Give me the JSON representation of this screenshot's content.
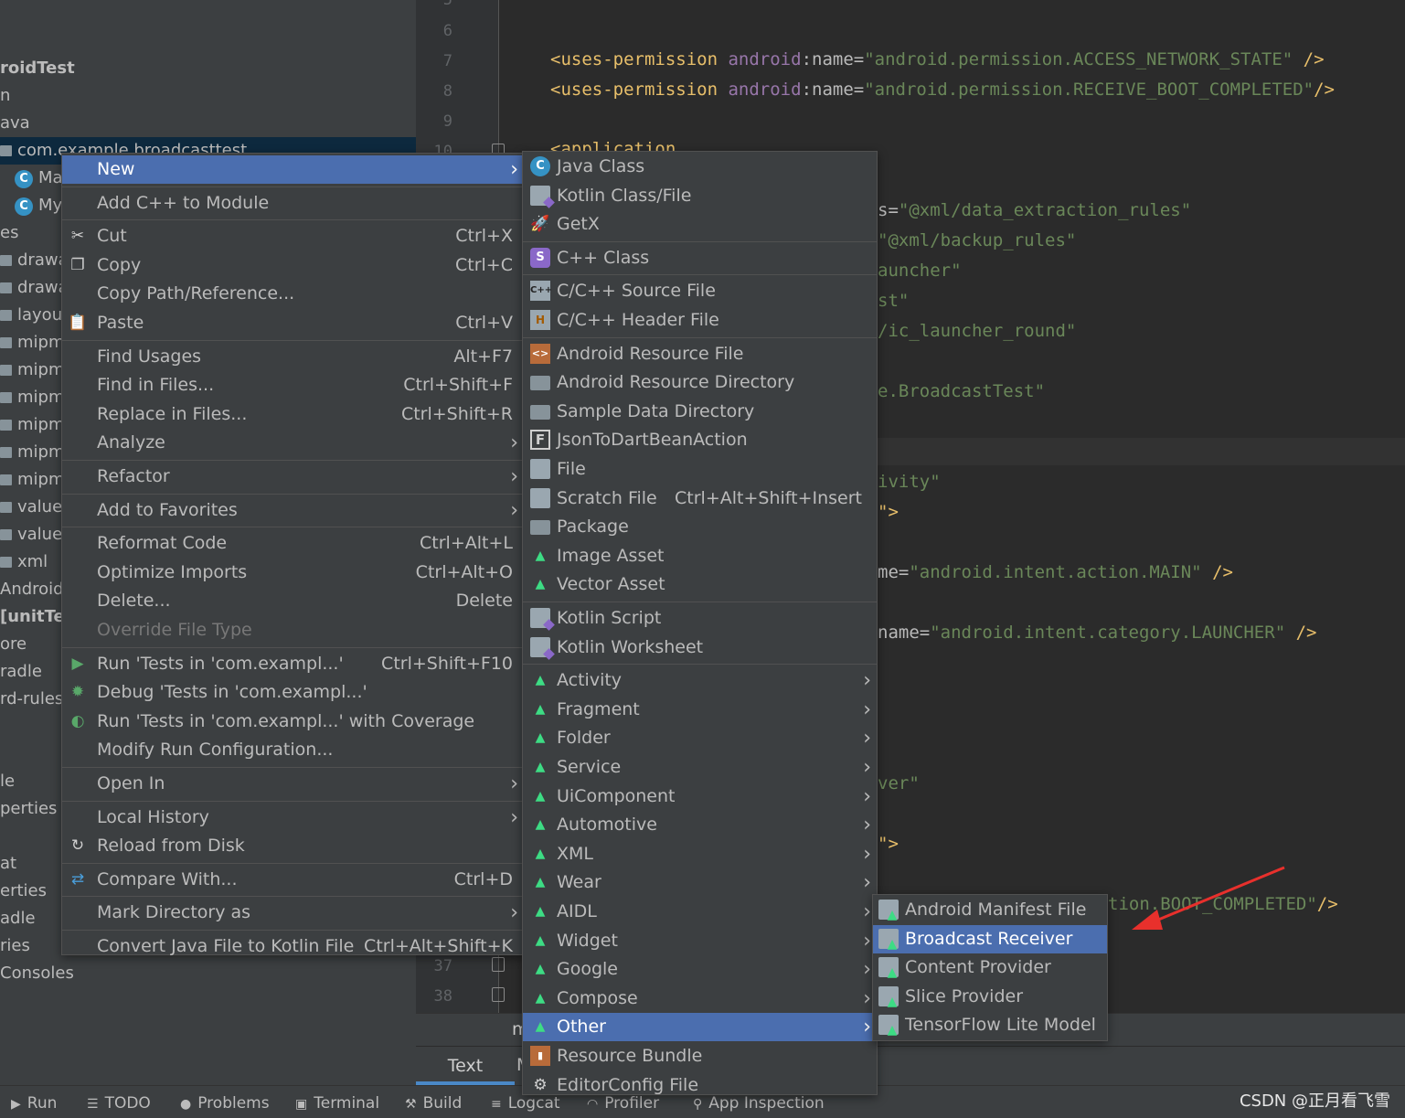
{
  "project_tree": [
    {
      "text": "roidTest",
      "bold": true
    },
    {
      "text": "n"
    },
    {
      "text": "ava"
    },
    {
      "text": "com.example.broadcasttest",
      "selected": true
    },
    {
      "text": "Ma",
      "class_icon": "C"
    },
    {
      "text": "My",
      "class_icon": "C"
    },
    {
      "text": "es"
    },
    {
      "text": "drawa",
      "folder": true
    },
    {
      "text": "drawa",
      "folder": true
    },
    {
      "text": "layout",
      "folder": true
    },
    {
      "text": "mipm",
      "folder": true
    },
    {
      "text": "mipm",
      "folder": true
    },
    {
      "text": "mipm",
      "folder": true
    },
    {
      "text": "mipm",
      "folder": true
    },
    {
      "text": "mipm",
      "folder": true
    },
    {
      "text": "mipm",
      "folder": true
    },
    {
      "text": "values",
      "folder": true
    },
    {
      "text": "values",
      "folder": true
    },
    {
      "text": "xml",
      "folder": true
    },
    {
      "text": "AndroidM"
    },
    {
      "text": "[unitTes",
      "bold": true
    },
    {
      "text": "ore"
    },
    {
      "text": "radle"
    },
    {
      "text": "rd-rules"
    },
    {
      "text": ""
    },
    {
      "text": ""
    },
    {
      "text": "le"
    },
    {
      "text": "perties"
    },
    {
      "text": ""
    },
    {
      "text": "at"
    },
    {
      "text": "erties"
    },
    {
      "text": "adle"
    },
    {
      "text": "ries"
    },
    {
      "text": " Consoles"
    }
  ],
  "line_numbers": [
    "5",
    "6",
    "7",
    "8",
    "9",
    "10",
    "37",
    "38"
  ],
  "code": {
    "l7_tag": "<uses-permission",
    "l7_ns": "android",
    "l7_attr": ":name=",
    "l7_val": "\"android.permission.ACCESS_NETWORK_STATE\"",
    "l7_end": " />",
    "l8_tag": "<uses-permission",
    "l8_ns": "android",
    "l8_attr": ":name=",
    "l8_val": "\"android.permission.RECEIVE_BOOT_COMPLETED\"",
    "l8_end": "/>",
    "l10": "<application",
    "f1_a": "s=",
    "f1_b": "\"@xml/data_extraction_rules\"",
    "f2": "\"@xml/backup_rules\"",
    "f3": "auncher\"",
    "f4": "st\"",
    "f5": "/ic_launcher_round\"",
    "f6": "e.BroadcastTest\"",
    "f7": "ivity\"",
    "f8": "\">",
    "f9_a": "me=",
    "f9_b": "\"android.intent.action.MAIN\"",
    "f9_c": " />",
    "f10_a": "name=",
    "f10_b": "\"android.intent.category.LAUNCHER\"",
    "f10_c": " />",
    "f11": "ver\"",
    "f12": "\">",
    "f13_a": "tion.BOOT_COMPLETED\"",
    "f13_b": "/>"
  },
  "editor_footer": {
    "text_tab": "Text",
    "m": "m",
    "M": "M"
  },
  "context_menu": {
    "items": [
      {
        "label": "New",
        "arrow": true,
        "selected": true
      },
      {
        "sep": true
      },
      {
        "label": "Add C++ to Module"
      },
      {
        "sep": true
      },
      {
        "label": "Cut",
        "shortcut": "Ctrl+X",
        "icon": "cut-icon"
      },
      {
        "label": "Copy",
        "shortcut": "Ctrl+C",
        "icon": "copy-icon"
      },
      {
        "label": "Copy Path/Reference..."
      },
      {
        "label": "Paste",
        "shortcut": "Ctrl+V",
        "icon": "paste-icon"
      },
      {
        "sep": true
      },
      {
        "label": "Find Usages",
        "shortcut": "Alt+F7"
      },
      {
        "label": "Find in Files...",
        "shortcut": "Ctrl+Shift+F"
      },
      {
        "label": "Replace in Files...",
        "shortcut": "Ctrl+Shift+R"
      },
      {
        "label": "Analyze",
        "arrow": true
      },
      {
        "sep": true
      },
      {
        "label": "Refactor",
        "arrow": true
      },
      {
        "sep": true
      },
      {
        "label": "Add to Favorites",
        "arrow": true
      },
      {
        "sep": true
      },
      {
        "label": "Reformat Code",
        "shortcut": "Ctrl+Alt+L"
      },
      {
        "label": "Optimize Imports",
        "shortcut": "Ctrl+Alt+O"
      },
      {
        "label": "Delete...",
        "shortcut": "Delete"
      },
      {
        "label": "Override File Type",
        "disabled": true
      },
      {
        "sep": true
      },
      {
        "label": "Run 'Tests in 'com.exampl...'",
        "shortcut": "Ctrl+Shift+F10",
        "icon": "run-icon"
      },
      {
        "label": "Debug 'Tests in 'com.exampl...'",
        "icon": "debug-icon"
      },
      {
        "label": "Run 'Tests in 'com.exampl...' with Coverage",
        "icon": "coverage-icon"
      },
      {
        "label": "Modify Run Configuration..."
      },
      {
        "sep": true
      },
      {
        "label": "Open In",
        "arrow": true
      },
      {
        "sep": true
      },
      {
        "label": "Local History",
        "arrow": true
      },
      {
        "label": "Reload from Disk",
        "icon": "reload-icon"
      },
      {
        "sep": true
      },
      {
        "label": "Compare With...",
        "shortcut": "Ctrl+D",
        "icon": "compare-icon"
      },
      {
        "sep": true
      },
      {
        "label": "Mark Directory as",
        "arrow": true
      },
      {
        "sep": true
      },
      {
        "label": "Convert Java File to Kotlin File",
        "shortcut": "Ctrl+Alt+Shift+K"
      }
    ]
  },
  "new_submenu": {
    "items": [
      {
        "label": "Java Class",
        "icon": "java-class-icon"
      },
      {
        "label": "Kotlin Class/File",
        "icon": "kotlin-file-icon"
      },
      {
        "label": "GetX",
        "icon": "getx-icon"
      },
      {
        "sep": true
      },
      {
        "label": "C++ Class",
        "icon": "cpp-class-icon"
      },
      {
        "sep": true
      },
      {
        "label": "C/C++ Source File",
        "icon": "cpp-source-icon"
      },
      {
        "label": "C/C++ Header File",
        "icon": "cpp-header-icon"
      },
      {
        "sep": true
      },
      {
        "label": "Android Resource File",
        "icon": "resource-file-icon"
      },
      {
        "label": "Android Resource Directory",
        "icon": "folder-icon"
      },
      {
        "label": "Sample Data Directory",
        "icon": "folder-icon"
      },
      {
        "label": "JsonToDartBeanAction",
        "icon": "json-to-dart-icon"
      },
      {
        "label": "File",
        "icon": "file-icon"
      },
      {
        "label": "Scratch File",
        "shortcut": "Ctrl+Alt+Shift+Insert",
        "icon": "scratch-file-icon"
      },
      {
        "label": "Package",
        "icon": "package-icon"
      },
      {
        "label": "Image Asset",
        "icon": "android-icon"
      },
      {
        "label": "Vector Asset",
        "icon": "android-icon"
      },
      {
        "sep": true
      },
      {
        "label": "Kotlin Script",
        "icon": "kotlin-script-icon"
      },
      {
        "label": "Kotlin Worksheet",
        "icon": "kotlin-worksheet-icon"
      },
      {
        "sep": true
      },
      {
        "label": "Activity",
        "arrow": true,
        "icon": "android-icon"
      },
      {
        "label": "Fragment",
        "arrow": true,
        "icon": "android-icon"
      },
      {
        "label": "Folder",
        "arrow": true,
        "icon": "android-icon"
      },
      {
        "label": "Service",
        "arrow": true,
        "icon": "android-icon"
      },
      {
        "label": "UiComponent",
        "arrow": true,
        "icon": "android-icon"
      },
      {
        "label": "Automotive",
        "arrow": true,
        "icon": "android-icon"
      },
      {
        "label": "XML",
        "arrow": true,
        "icon": "android-icon"
      },
      {
        "label": "Wear",
        "arrow": true,
        "icon": "android-icon"
      },
      {
        "label": "AIDL",
        "arrow": true,
        "icon": "android-icon"
      },
      {
        "label": "Widget",
        "arrow": true,
        "icon": "android-icon"
      },
      {
        "label": "Google",
        "arrow": true,
        "icon": "android-icon"
      },
      {
        "label": "Compose",
        "arrow": true,
        "icon": "android-icon"
      },
      {
        "label": "Other",
        "arrow": true,
        "selected": true,
        "icon": "android-icon"
      },
      {
        "label": "Resource Bundle",
        "icon": "resource-bundle-icon"
      },
      {
        "label": "EditorConfig File",
        "icon": "gear-icon"
      }
    ]
  },
  "other_submenu": {
    "items": [
      {
        "label": "Android Manifest File",
        "icon": "android-doc-icon"
      },
      {
        "label": "Broadcast Receiver",
        "selected": true,
        "icon": "android-doc-icon"
      },
      {
        "label": "Content Provider",
        "icon": "android-doc-icon"
      },
      {
        "label": "Slice Provider",
        "icon": "android-doc-icon"
      },
      {
        "label": "TensorFlow Lite Model",
        "icon": "android-doc-icon"
      }
    ]
  },
  "statusbar": [
    {
      "label": "Run",
      "icon": "run-icon"
    },
    {
      "label": "TODO",
      "icon": "list-icon"
    },
    {
      "label": "Problems",
      "icon": "info-icon"
    },
    {
      "label": "Terminal",
      "icon": "terminal-icon"
    },
    {
      "label": "Build",
      "icon": "hammer-icon"
    },
    {
      "label": "Logcat",
      "icon": "logcat-icon"
    },
    {
      "label": "Profiler",
      "icon": "gauge-icon"
    },
    {
      "label": "App Inspection",
      "icon": "inspect-icon"
    }
  ],
  "watermark": "CSDN @正月看飞雪",
  "annotation_color": "#e8302c",
  "selection_color": "#4b6eaf"
}
